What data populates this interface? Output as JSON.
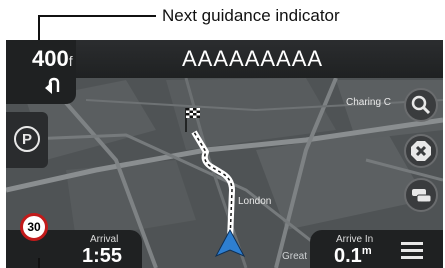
{
  "callout": {
    "text": "Next guidance indicator"
  },
  "guidance": {
    "distance": "400",
    "distance_unit_fragment": "f",
    "road_name": "AAAAAAAAA"
  },
  "map_labels": {
    "charing": "Charing C",
    "london": "London",
    "great": "Great S"
  },
  "speed_limit": {
    "value": "30"
  },
  "arrival": {
    "label": "Arrival",
    "time": "1:55"
  },
  "arrive_in": {
    "label": "Arrive In",
    "value": "0.1",
    "unit": "m"
  },
  "icons": {
    "turn": "u-turn-arrow-icon",
    "parking": "parking-icon",
    "search": "search-icon",
    "cancel": "cancel-route-icon",
    "traffic": "traffic-icon",
    "menu": "menu-icon"
  },
  "colors": {
    "route": "#ffffff",
    "speed_sign_border": "#c21a1a",
    "vehicle_arrow": "#2e7fd1"
  }
}
